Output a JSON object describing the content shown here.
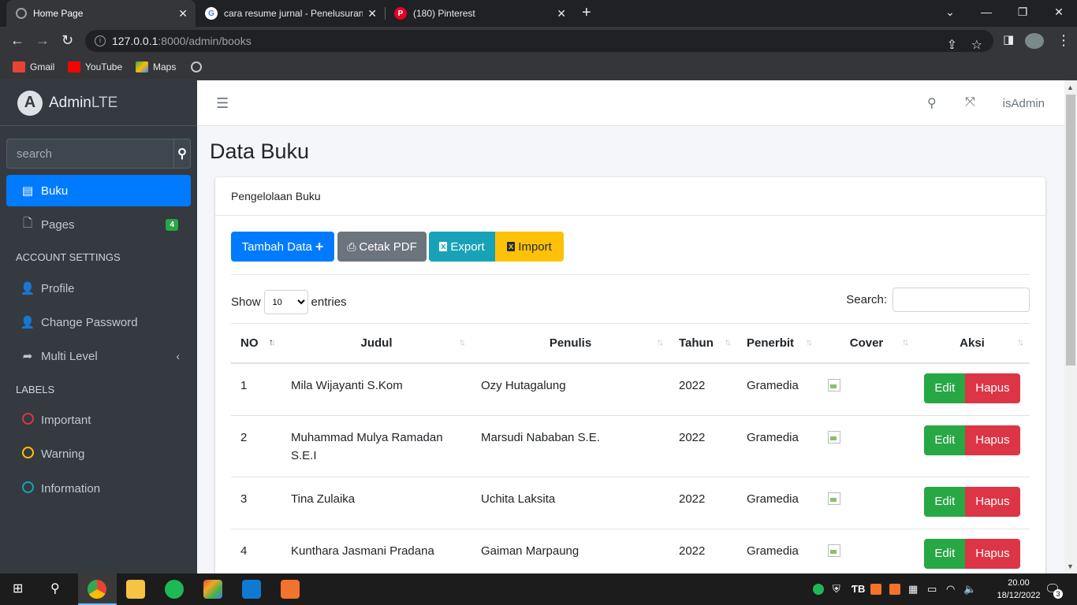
{
  "browser": {
    "tabs": [
      {
        "title": "Home Page",
        "active": true
      },
      {
        "title": "cara resume jurnal - Penelusuran"
      },
      {
        "title": "(180) Pinterest"
      }
    ],
    "url_host": "127.0.0.1",
    "url_path": ":8000/admin/books",
    "bookmarks": [
      "Gmail",
      "YouTube",
      "Maps"
    ]
  },
  "sidebar": {
    "brand_bold": "Admin",
    "brand_light": "LTE",
    "search_placeholder": "search",
    "items": [
      {
        "label": "Buku",
        "icon": "book-icon",
        "active": true
      },
      {
        "label": "Pages",
        "icon": "file-icon",
        "badge": "4"
      }
    ],
    "account_header": "ACCOUNT SETTINGS",
    "account_items": [
      {
        "label": "Profile",
        "icon": "user-icon"
      },
      {
        "label": "Change Password",
        "icon": "user-icon"
      },
      {
        "label": "Multi Level",
        "icon": "share-icon"
      }
    ],
    "labels_header": "LABELS",
    "labels": [
      {
        "label": "Important",
        "color": "#dc3545"
      },
      {
        "label": "Warning",
        "color": "#ffc107"
      },
      {
        "label": "Information",
        "color": "#17a2b8"
      }
    ]
  },
  "topnav": {
    "user": "isAdmin"
  },
  "page": {
    "title": "Data Buku",
    "card_header": "Pengelolaan Buku"
  },
  "actions": {
    "tambah": "Tambah Data",
    "cetak": "Cetak PDF",
    "export": "Export",
    "import": "Import"
  },
  "datatable": {
    "show": "Show",
    "entries_value": "10",
    "entries": "entries",
    "search": "Search:",
    "columns": [
      "NO",
      "Judul",
      "Penulis",
      "Tahun",
      "Penerbit",
      "Cover",
      "Aksi"
    ],
    "rows": [
      {
        "no": "1",
        "judul": "Mila Wijayanti S.Kom",
        "penulis": "Ozy Hutagalung",
        "tahun": "2022",
        "penerbit": "Gramedia"
      },
      {
        "no": "2",
        "judul": "Muhammad Mulya Ramadan S.E.I",
        "penulis": "Marsudi Nababan S.E.",
        "tahun": "2022",
        "penerbit": "Gramedia"
      },
      {
        "no": "3",
        "judul": "Tina Zulaika",
        "penulis": "Uchita Laksita",
        "tahun": "2022",
        "penerbit": "Gramedia"
      },
      {
        "no": "4",
        "judul": "Kunthara Jasmani Pradana",
        "penulis": "Gaiman Marpaung",
        "tahun": "2022",
        "penerbit": "Gramedia"
      }
    ],
    "edit_label": "Edit",
    "hapus_label": "Hapus"
  },
  "taskbar": {
    "time": "20.00",
    "date": "18/12/2022",
    "notifications": "3"
  }
}
